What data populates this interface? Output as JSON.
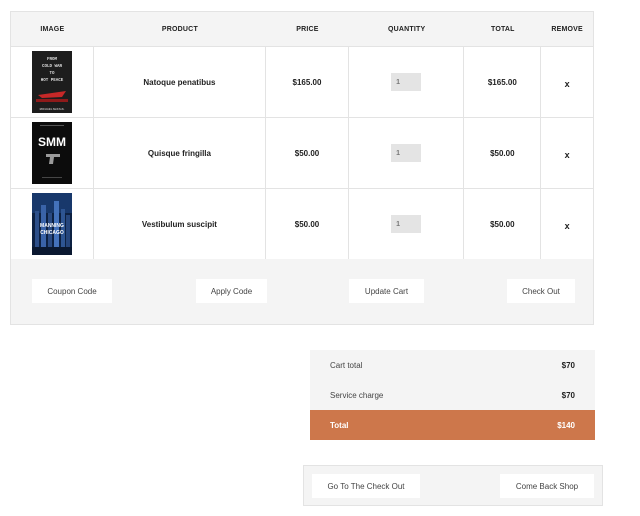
{
  "table": {
    "headers": {
      "image": "IMAGE",
      "product": "PRODUCT",
      "price": "PRICE",
      "quantity": "QUANTITY",
      "total": "TOTAL",
      "remove": "REMOVE"
    },
    "rows": [
      {
        "product": "Natoque penatibus",
        "price": "$165.00",
        "quantity": "1",
        "total": "$165.00",
        "remove": "x",
        "cover_lines": [
          "FROM",
          "COLD WAR",
          "TO",
          "HOT PEACE"
        ],
        "cover_author": "MICHAEL McFAUL"
      },
      {
        "product": "Quisque fringilla",
        "price": "$50.00",
        "quantity": "1",
        "total": "$50.00",
        "remove": "x",
        "cover_lines": [
          "SMM"
        ],
        "cover_author": ""
      },
      {
        "product": "Vestibulum suscipit",
        "price": "$50.00",
        "quantity": "1",
        "total": "$50.00",
        "remove": "x",
        "cover_lines": [
          "MANNING",
          "CHICAGO"
        ],
        "cover_author": ""
      }
    ]
  },
  "actions": {
    "coupon_placeholder": "Coupon Code",
    "apply": "Apply Code",
    "update": "Update Cart",
    "checkout": "Check Out"
  },
  "totals": {
    "cart_total_label": "Cart total",
    "cart_total_value": "$70",
    "service_label": "Service charge",
    "service_value": "$70",
    "total_label": "Total",
    "total_value": "$140"
  },
  "bottom": {
    "goto_checkout": "Go To The Check Out",
    "come_back": "Come Back Shop"
  },
  "colors": {
    "accent": "#cd774b",
    "panel": "#f4f4f4"
  }
}
